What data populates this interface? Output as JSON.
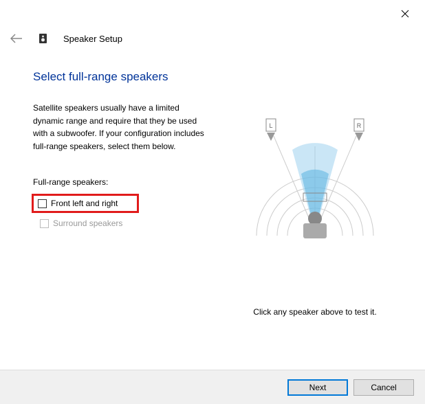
{
  "window": {
    "title": "Speaker Setup"
  },
  "page": {
    "heading": "Select full-range speakers",
    "description": "Satellite speakers usually have a limited dynamic range and require that they be used with a subwoofer.  If your configuration includes full-range speakers, select them below.",
    "section_label": "Full-range speakers:",
    "options": {
      "front": "Front left and right",
      "surround": "Surround speakers"
    },
    "hint": "Click any speaker above to test it."
  },
  "diagram": {
    "left_label": "L",
    "right_label": "R"
  },
  "footer": {
    "next": "Next",
    "cancel": "Cancel"
  }
}
